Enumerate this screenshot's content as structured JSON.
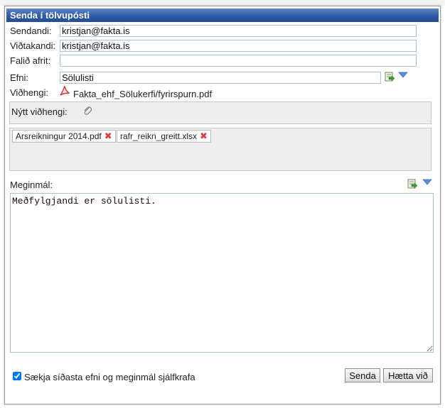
{
  "dialog": {
    "title": "Senda í tölvupósti"
  },
  "fields": {
    "sender": {
      "label": "Sendandi:",
      "value": "kristjan@fakta.is"
    },
    "recipient": {
      "label": "Viðtakandi:",
      "value": "kristjan@fakta.is"
    },
    "bcc": {
      "label": "Falið afrit:",
      "value": ""
    },
    "subject": {
      "label": "Efni:",
      "value": "Sölulisti"
    }
  },
  "attachment": {
    "label": "Viðhengi:",
    "file": "Fakta_ehf_Sölukerfi/fyrirspurn.pdf",
    "icon": "pdf-icon"
  },
  "new_attachment": {
    "label": "Nýtt viðhengi:",
    "icon": "paperclip-icon"
  },
  "attached_files": [
    {
      "name": "Arsreikningur 2014.pdf"
    },
    {
      "name": "rafr_reikn_greitt.xlsx"
    }
  ],
  "body": {
    "label": "Meginmál:",
    "text": "Meðfylgjandi er sölulisti."
  },
  "auto_fetch": {
    "label": "Sækja síðasta efni og meginmál sjálfkrafa",
    "checked": true
  },
  "buttons": {
    "send": "Senda",
    "cancel": "Hætta við"
  },
  "colors": {
    "title_bar": "#2f5aa4",
    "input_border": "#a9c2d6",
    "remove": "#e0393e",
    "panel": "#eeeeee"
  }
}
